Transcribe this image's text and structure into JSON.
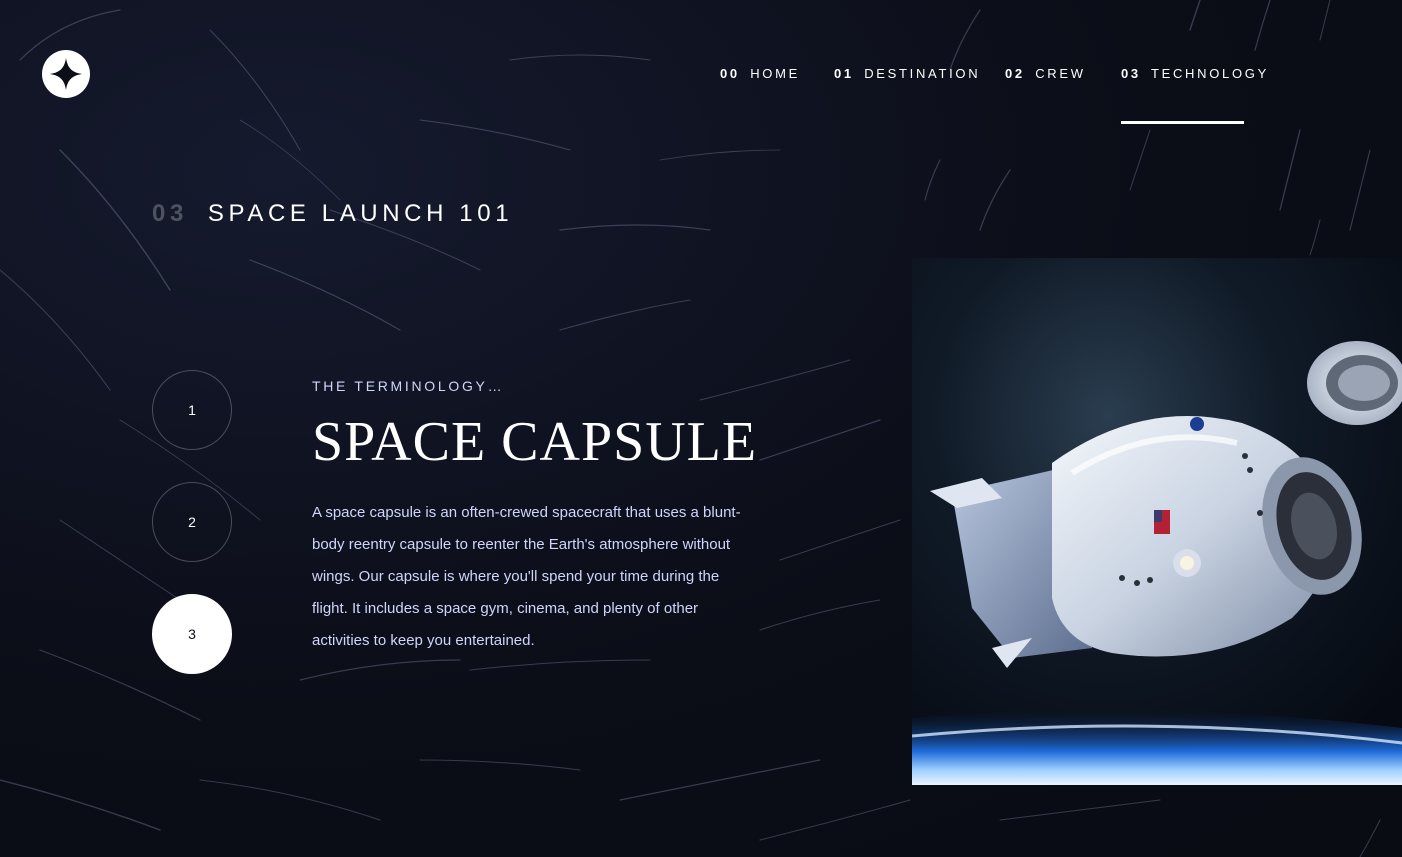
{
  "header": {
    "logo_icon": "star-logo-icon",
    "nav": [
      {
        "num": "00",
        "label": "HOME"
      },
      {
        "num": "01",
        "label": "DESTINATION"
      },
      {
        "num": "02",
        "label": "CREW"
      },
      {
        "num": "03",
        "label": "TECHNOLOGY"
      }
    ],
    "active_index": 3
  },
  "page_heading": {
    "num": "03",
    "label": "SPACE LAUNCH 101"
  },
  "steps": [
    "1",
    "2",
    "3"
  ],
  "active_step": 3,
  "content": {
    "eyebrow": "THE TERMINOLOGY…",
    "title": "SPACE CAPSULE",
    "description": "A space capsule is an often-crewed spacecraft that uses a blunt-body reentry capsule to reenter the Earth's atmosphere without wings. Our capsule is where you'll spend your time during the flight. It includes a space gym, cinema, and plenty of other activities to keep you entertained."
  },
  "image": {
    "name": "space-capsule-image"
  },
  "colors": {
    "background": "#0b0d17",
    "accent_text": "#d0d6f9",
    "white": "#ffffff"
  }
}
